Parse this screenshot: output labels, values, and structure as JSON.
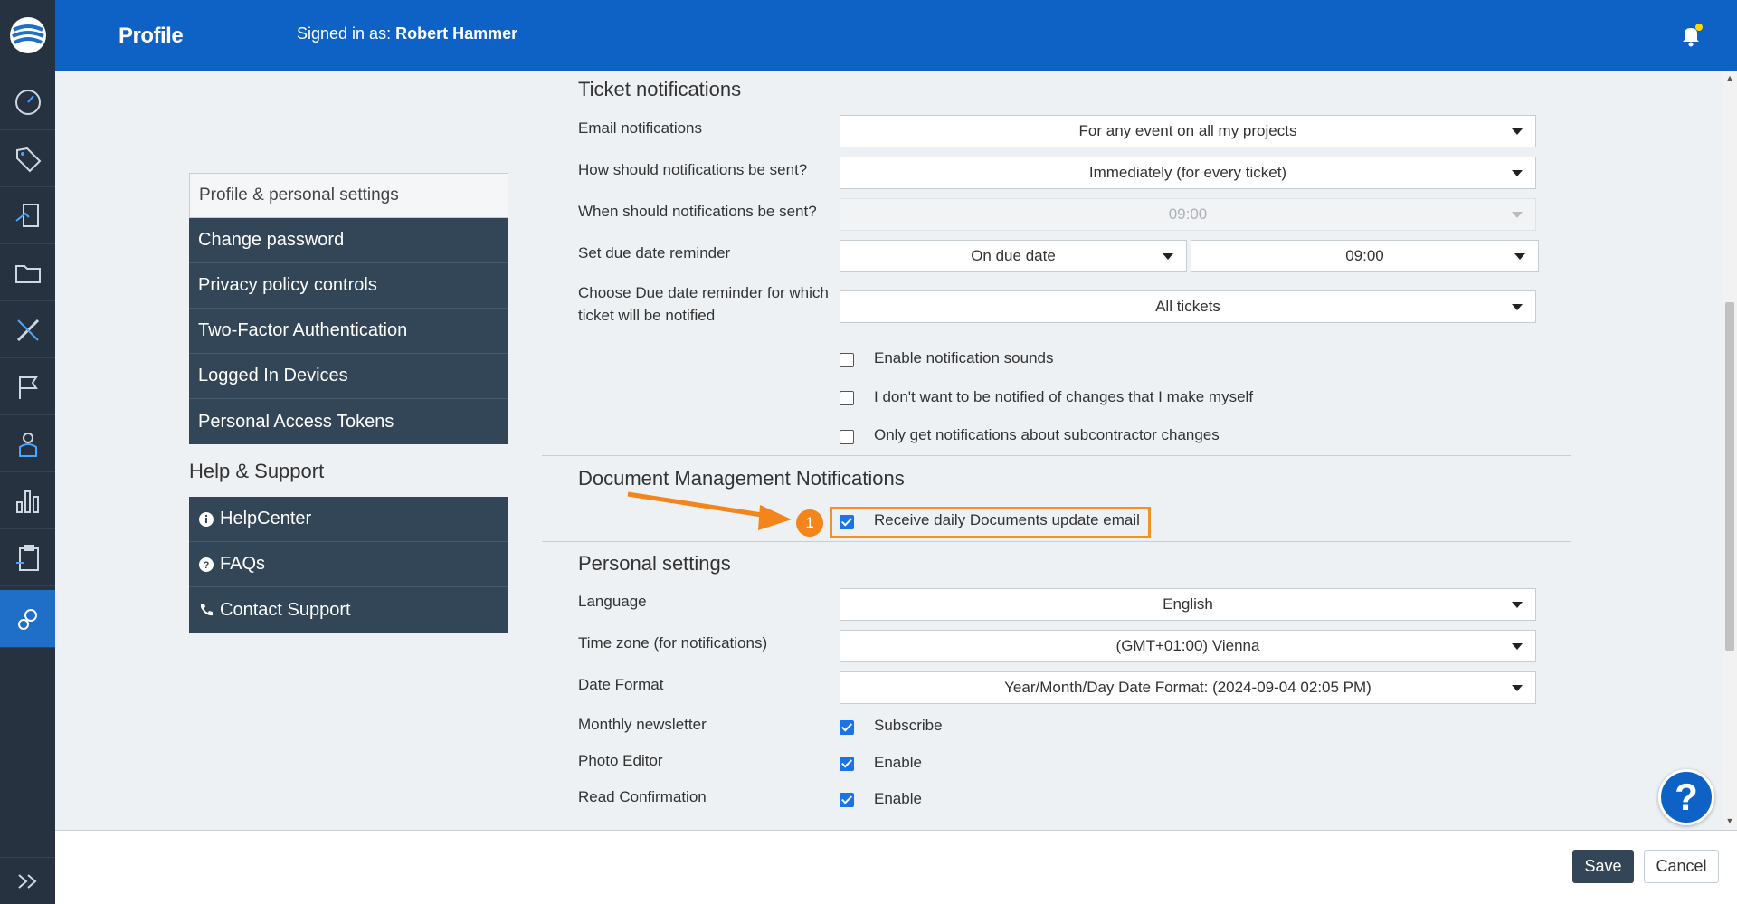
{
  "header": {
    "title": "Profile",
    "signed_in_prefix": "Signed in as:",
    "user_name": "Robert Hammer"
  },
  "rail": {
    "icons": [
      "logo-icon",
      "dashboard-icon",
      "tag-icon",
      "plans-icon",
      "folder-icon",
      "tools-icon",
      "flag-icon",
      "person-icon",
      "chart-icon",
      "clipboard-icon",
      "settings-icon"
    ],
    "active": "settings-icon"
  },
  "side_menu": {
    "header": "Profile & personal settings",
    "items": [
      {
        "label": "Change password"
      },
      {
        "label": "Privacy policy controls"
      },
      {
        "label": "Two-Factor Authentication"
      },
      {
        "label": "Logged In Devices"
      },
      {
        "label": "Personal Access Tokens"
      }
    ]
  },
  "support_menu": {
    "title": "Help & Support",
    "items": [
      {
        "label": "HelpCenter",
        "icon": "info-icon"
      },
      {
        "label": "FAQs",
        "icon": "question-icon"
      },
      {
        "label": "Contact Support",
        "icon": "phone-icon"
      }
    ]
  },
  "ticket_notifications": {
    "title": "Ticket notifications",
    "email_label": "Email notifications",
    "email_value": "For any event on all my projects",
    "how_label": "How should notifications be sent?",
    "how_value": "Immediately (for every ticket)",
    "when_label": "When should notifications be sent?",
    "when_value": "09:00",
    "reminder_label": "Set due date reminder",
    "reminder_value": "On due date",
    "reminder_time": "09:00",
    "choose_label_line1": "Choose Due date reminder for which",
    "choose_label_line2": "ticket will be notified",
    "choose_value": "All tickets",
    "checkboxes": [
      {
        "label": "Enable notification sounds",
        "checked": false
      },
      {
        "label": "I don't want to be notified of changes that I make myself",
        "checked": false
      },
      {
        "label": "Only get notifications about subcontractor changes",
        "checked": false
      }
    ]
  },
  "document_management": {
    "title": "Document Management Notifications",
    "checkbox_label": "Receive daily Documents update email",
    "checked": true,
    "callout_number": "1"
  },
  "personal_settings": {
    "title": "Personal settings",
    "language_label": "Language",
    "language_value": "English",
    "timezone_label": "Time zone (for notifications)",
    "timezone_value": "(GMT+01:00) Vienna",
    "date_format_label": "Date Format",
    "date_format_value": "Year/Month/Day Date Format: (2024-09-04 02:05 PM)",
    "newsletter_label": "Monthly newsletter",
    "newsletter_option": "Subscribe",
    "photo_editor_label": "Photo Editor",
    "photo_editor_option": "Enable",
    "read_confirmation_label": "Read Confirmation",
    "read_confirmation_option": "Enable"
  },
  "footer": {
    "save_label": "Save",
    "cancel_label": "Cancel"
  },
  "help_fab": "?",
  "colors": {
    "header": "#0e62c6",
    "rail": "#26323f",
    "menu": "#324657",
    "highlight": "#f39220",
    "checkbox": "#1a73e8"
  }
}
